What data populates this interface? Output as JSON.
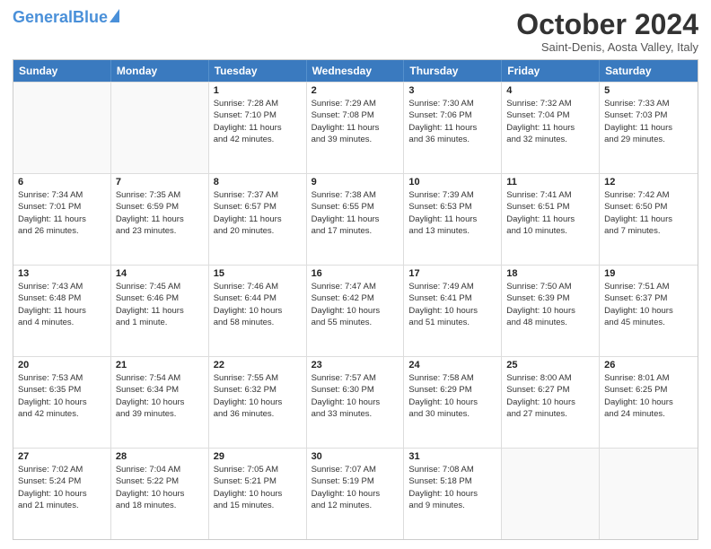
{
  "header": {
    "logo_general": "General",
    "logo_blue": "Blue",
    "month_title": "October 2024",
    "subtitle": "Saint-Denis, Aosta Valley, Italy"
  },
  "days_of_week": [
    "Sunday",
    "Monday",
    "Tuesday",
    "Wednesday",
    "Thursday",
    "Friday",
    "Saturday"
  ],
  "weeks": [
    [
      {
        "day": "",
        "lines": []
      },
      {
        "day": "",
        "lines": []
      },
      {
        "day": "1",
        "lines": [
          "Sunrise: 7:28 AM",
          "Sunset: 7:10 PM",
          "Daylight: 11 hours",
          "and 42 minutes."
        ]
      },
      {
        "day": "2",
        "lines": [
          "Sunrise: 7:29 AM",
          "Sunset: 7:08 PM",
          "Daylight: 11 hours",
          "and 39 minutes."
        ]
      },
      {
        "day": "3",
        "lines": [
          "Sunrise: 7:30 AM",
          "Sunset: 7:06 PM",
          "Daylight: 11 hours",
          "and 36 minutes."
        ]
      },
      {
        "day": "4",
        "lines": [
          "Sunrise: 7:32 AM",
          "Sunset: 7:04 PM",
          "Daylight: 11 hours",
          "and 32 minutes."
        ]
      },
      {
        "day": "5",
        "lines": [
          "Sunrise: 7:33 AM",
          "Sunset: 7:03 PM",
          "Daylight: 11 hours",
          "and 29 minutes."
        ]
      }
    ],
    [
      {
        "day": "6",
        "lines": [
          "Sunrise: 7:34 AM",
          "Sunset: 7:01 PM",
          "Daylight: 11 hours",
          "and 26 minutes."
        ]
      },
      {
        "day": "7",
        "lines": [
          "Sunrise: 7:35 AM",
          "Sunset: 6:59 PM",
          "Daylight: 11 hours",
          "and 23 minutes."
        ]
      },
      {
        "day": "8",
        "lines": [
          "Sunrise: 7:37 AM",
          "Sunset: 6:57 PM",
          "Daylight: 11 hours",
          "and 20 minutes."
        ]
      },
      {
        "day": "9",
        "lines": [
          "Sunrise: 7:38 AM",
          "Sunset: 6:55 PM",
          "Daylight: 11 hours",
          "and 17 minutes."
        ]
      },
      {
        "day": "10",
        "lines": [
          "Sunrise: 7:39 AM",
          "Sunset: 6:53 PM",
          "Daylight: 11 hours",
          "and 13 minutes."
        ]
      },
      {
        "day": "11",
        "lines": [
          "Sunrise: 7:41 AM",
          "Sunset: 6:51 PM",
          "Daylight: 11 hours",
          "and 10 minutes."
        ]
      },
      {
        "day": "12",
        "lines": [
          "Sunrise: 7:42 AM",
          "Sunset: 6:50 PM",
          "Daylight: 11 hours",
          "and 7 minutes."
        ]
      }
    ],
    [
      {
        "day": "13",
        "lines": [
          "Sunrise: 7:43 AM",
          "Sunset: 6:48 PM",
          "Daylight: 11 hours",
          "and 4 minutes."
        ]
      },
      {
        "day": "14",
        "lines": [
          "Sunrise: 7:45 AM",
          "Sunset: 6:46 PM",
          "Daylight: 11 hours",
          "and 1 minute."
        ]
      },
      {
        "day": "15",
        "lines": [
          "Sunrise: 7:46 AM",
          "Sunset: 6:44 PM",
          "Daylight: 10 hours",
          "and 58 minutes."
        ]
      },
      {
        "day": "16",
        "lines": [
          "Sunrise: 7:47 AM",
          "Sunset: 6:42 PM",
          "Daylight: 10 hours",
          "and 55 minutes."
        ]
      },
      {
        "day": "17",
        "lines": [
          "Sunrise: 7:49 AM",
          "Sunset: 6:41 PM",
          "Daylight: 10 hours",
          "and 51 minutes."
        ]
      },
      {
        "day": "18",
        "lines": [
          "Sunrise: 7:50 AM",
          "Sunset: 6:39 PM",
          "Daylight: 10 hours",
          "and 48 minutes."
        ]
      },
      {
        "day": "19",
        "lines": [
          "Sunrise: 7:51 AM",
          "Sunset: 6:37 PM",
          "Daylight: 10 hours",
          "and 45 minutes."
        ]
      }
    ],
    [
      {
        "day": "20",
        "lines": [
          "Sunrise: 7:53 AM",
          "Sunset: 6:35 PM",
          "Daylight: 10 hours",
          "and 42 minutes."
        ]
      },
      {
        "day": "21",
        "lines": [
          "Sunrise: 7:54 AM",
          "Sunset: 6:34 PM",
          "Daylight: 10 hours",
          "and 39 minutes."
        ]
      },
      {
        "day": "22",
        "lines": [
          "Sunrise: 7:55 AM",
          "Sunset: 6:32 PM",
          "Daylight: 10 hours",
          "and 36 minutes."
        ]
      },
      {
        "day": "23",
        "lines": [
          "Sunrise: 7:57 AM",
          "Sunset: 6:30 PM",
          "Daylight: 10 hours",
          "and 33 minutes."
        ]
      },
      {
        "day": "24",
        "lines": [
          "Sunrise: 7:58 AM",
          "Sunset: 6:29 PM",
          "Daylight: 10 hours",
          "and 30 minutes."
        ]
      },
      {
        "day": "25",
        "lines": [
          "Sunrise: 8:00 AM",
          "Sunset: 6:27 PM",
          "Daylight: 10 hours",
          "and 27 minutes."
        ]
      },
      {
        "day": "26",
        "lines": [
          "Sunrise: 8:01 AM",
          "Sunset: 6:25 PM",
          "Daylight: 10 hours",
          "and 24 minutes."
        ]
      }
    ],
    [
      {
        "day": "27",
        "lines": [
          "Sunrise: 7:02 AM",
          "Sunset: 5:24 PM",
          "Daylight: 10 hours",
          "and 21 minutes."
        ]
      },
      {
        "day": "28",
        "lines": [
          "Sunrise: 7:04 AM",
          "Sunset: 5:22 PM",
          "Daylight: 10 hours",
          "and 18 minutes."
        ]
      },
      {
        "day": "29",
        "lines": [
          "Sunrise: 7:05 AM",
          "Sunset: 5:21 PM",
          "Daylight: 10 hours",
          "and 15 minutes."
        ]
      },
      {
        "day": "30",
        "lines": [
          "Sunrise: 7:07 AM",
          "Sunset: 5:19 PM",
          "Daylight: 10 hours",
          "and 12 minutes."
        ]
      },
      {
        "day": "31",
        "lines": [
          "Sunrise: 7:08 AM",
          "Sunset: 5:18 PM",
          "Daylight: 10 hours",
          "and 9 minutes."
        ]
      },
      {
        "day": "",
        "lines": []
      },
      {
        "day": "",
        "lines": []
      }
    ]
  ]
}
